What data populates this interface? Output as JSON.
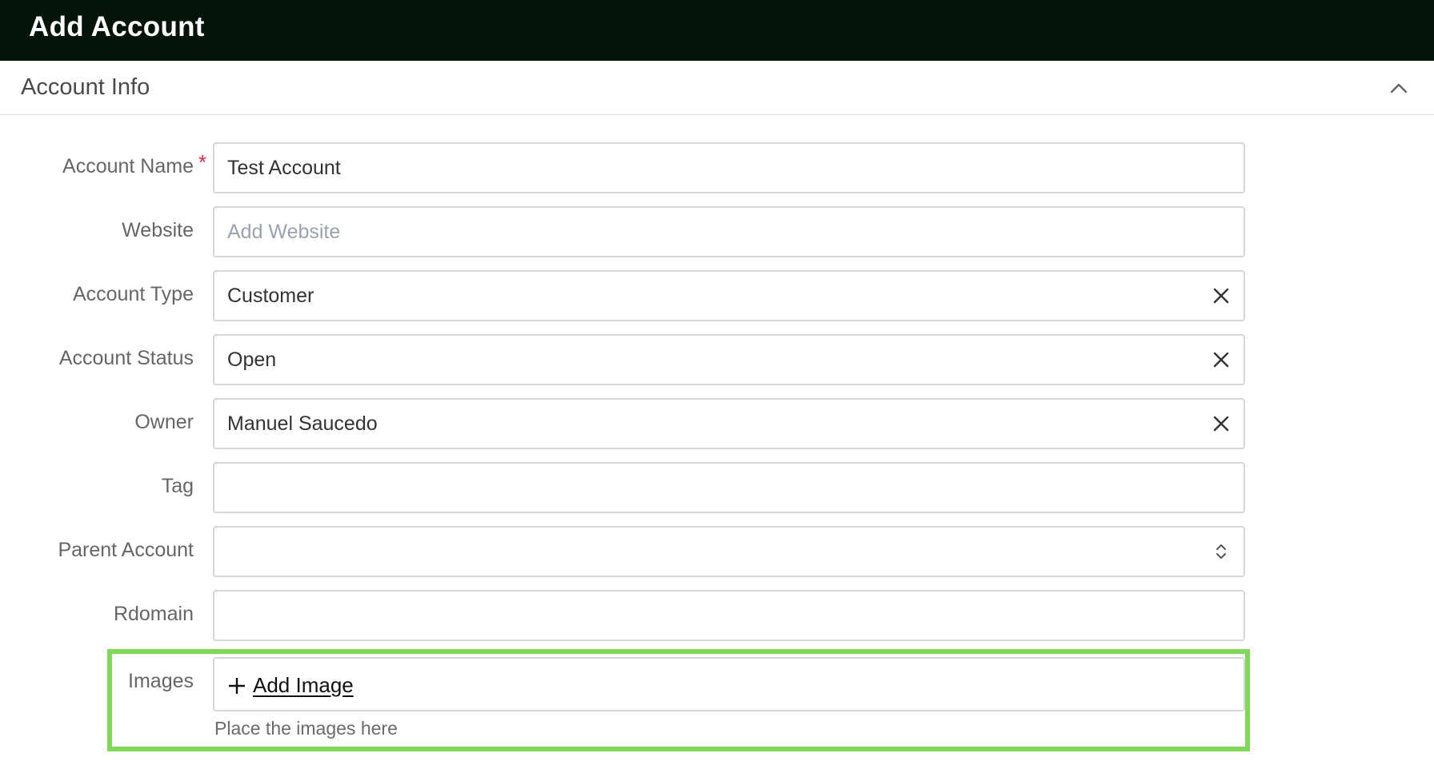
{
  "title": "Add Account",
  "section": {
    "title": "Account Info"
  },
  "fields": {
    "account_name": {
      "label": "Account Name",
      "required_mark": "*",
      "value": "Test Account"
    },
    "website": {
      "label": "Website",
      "placeholder": "Add Website",
      "value": ""
    },
    "account_type": {
      "label": "Account Type",
      "value": "Customer"
    },
    "account_status": {
      "label": "Account Status",
      "value": "Open"
    },
    "owner": {
      "label": "Owner",
      "value": "Manuel Saucedo"
    },
    "tag": {
      "label": "Tag",
      "value": ""
    },
    "parent_account": {
      "label": "Parent Account",
      "value": ""
    },
    "rdomain": {
      "label": "Rdomain",
      "value": ""
    }
  },
  "images": {
    "label": "Images",
    "add_label": "Add Image",
    "hint": "Place the images here"
  },
  "colors": {
    "titlebar_bg": "#04140a",
    "required": "#e0294a",
    "highlight": "#7ed957"
  },
  "icons": {
    "collapse": "chevron-up-icon",
    "clear": "close-icon",
    "stepper": "chevron-up-down-icon",
    "add": "plus-icon"
  }
}
